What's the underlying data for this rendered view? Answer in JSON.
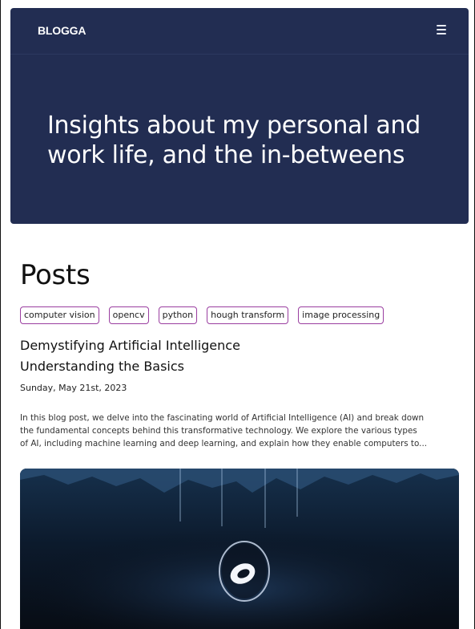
{
  "nav": {
    "logo": "BLOGGA",
    "menu_icon": "hamburger-menu-icon"
  },
  "hero": {
    "title_line1": "Insights about my personal and",
    "title_line2": "work life, and the in-betweens",
    "background": "#222d52"
  },
  "posts": {
    "heading": "Posts",
    "tags": [
      "computer vision",
      "opencv",
      "python",
      "hough transform",
      "image processing"
    ],
    "tag_border_color": "#9a3ea0",
    "items": [
      {
        "title_line1": "Demystifying Artificial Intelligence",
        "title_line2": "Understanding the Basics",
        "date": "Sunday, May 21st, 2023",
        "excerpt_line1": "In this blog post, we delve into the fascinating world of Artificial Intelligence (AI) and break down",
        "excerpt_line2": "the fundamental concepts behind this transformative technology. We explore the various types",
        "excerpt_line3": "of AI, including machine learning and deep learning, and explain how they enable computers to...",
        "image_icon": "ai-abstract-image"
      }
    ]
  }
}
